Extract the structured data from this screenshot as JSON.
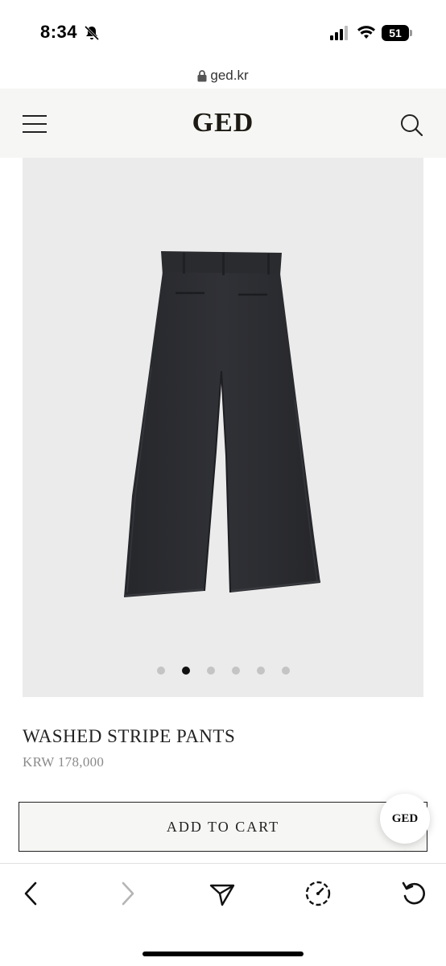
{
  "status_bar": {
    "time": "8:34",
    "battery_level": "51",
    "icons": [
      "bell-slash-icon",
      "cellular-signal-icon",
      "wifi-icon",
      "battery-icon"
    ]
  },
  "browser": {
    "url": "ged.kr"
  },
  "header": {
    "logo": "GED",
    "icons": [
      "menu-icon",
      "search-icon"
    ]
  },
  "product": {
    "name": "WASHED STRIPE PANTS",
    "price": "KRW 178,000",
    "image_count": 6,
    "active_image_index": 1,
    "add_to_cart_label": "ADD TO CART"
  },
  "chat_badge": {
    "label": "GED"
  },
  "toolbar": {
    "icons": [
      "back-icon",
      "forward-icon",
      "share-icon",
      "timer-icon",
      "reload-icon"
    ]
  },
  "colors": {
    "page_background": "#f6f6f4",
    "image_background": "#ebebeb",
    "pants": "#2a2b2f",
    "accent": "#1c1a12"
  }
}
